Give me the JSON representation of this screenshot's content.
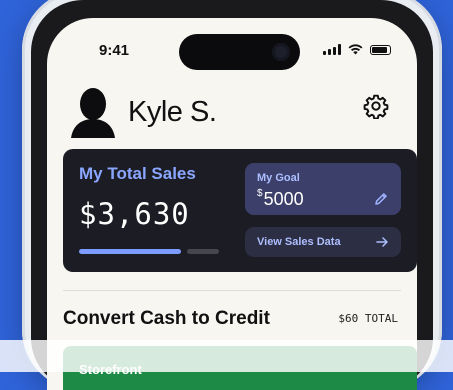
{
  "status_bar": {
    "time": "9:41"
  },
  "profile": {
    "name": "Kyle S."
  },
  "sales": {
    "title": "My Total Sales",
    "amount": "$3,630",
    "progress": 0.726,
    "goal": {
      "label": "My Goal",
      "currency": "$",
      "value": "5000"
    },
    "view_data_label": "View Sales Data"
  },
  "convert": {
    "title": "Convert Cash to Credit",
    "total": "$60 TOTAL"
  },
  "storefront": {
    "label": "Storefront"
  },
  "icons": {
    "settings": "gear-icon",
    "edit": "pencil-icon",
    "arrow": "arrow-right-icon",
    "avatar": "person-silhouette-icon",
    "signal": "cellular-signal-icon",
    "wifi": "wifi-icon",
    "battery": "battery-icon"
  },
  "colors": {
    "background": "#2f63d9",
    "card": "#1b1c24",
    "accent": "#8aa6ff",
    "goal_box": "#3b3f6a",
    "storefront": "#1d8a46"
  }
}
